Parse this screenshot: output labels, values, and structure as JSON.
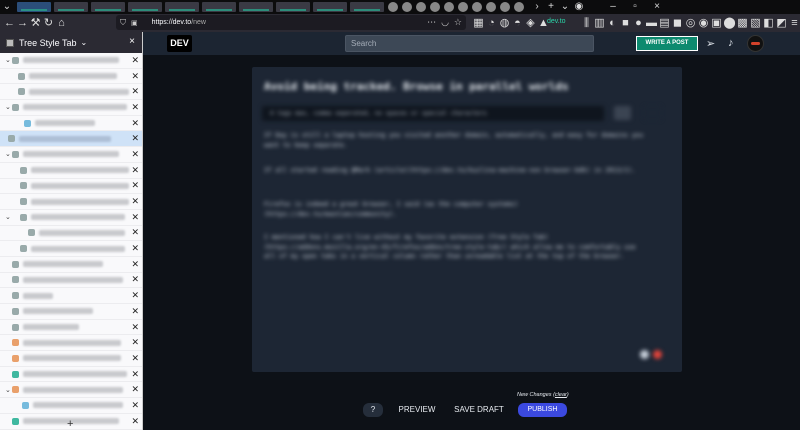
{
  "browser": {
    "url_host": "https://dev.to",
    "url_path": "/new",
    "site_chip": "dev.to"
  },
  "sidebar": {
    "title": "Tree Style Tab",
    "dropdown_glyph": "⌄",
    "close_label": "×",
    "add_label": "+"
  },
  "devto": {
    "logo": "DEV",
    "search_placeholder": "Search",
    "write_post": "WRITE A POST"
  },
  "editor": {
    "title": "Avoid being tracked. Browse in parallel worlds",
    "tags_placeholder": "4 tags max, comma seperated, no spaces or special characters",
    "paragraphs": [
      "If Day is still a laptop hosting you visited another domain, automatically, and easy for domains you want to keep separate.",
      "If all started reading @Mark (article)(https://dev.to/kuzlina-machine-non browser-bdk) in 2013/1).",
      "Firefox is indeed a great browser, I said (as the computer systems) (https://dev.to/mastian/community).",
      "I mentioned how I can't live without my favorite extension (Tree Style Tab)(https://addons.mozilla.org/en-US/firefox/addon/tree-style-tab/) which allow me to comfortably use all of my open tabs in a vertical column rather than unreadable list at the top of the browser."
    ]
  },
  "bottom": {
    "help": "?",
    "preview": "PREVIEW",
    "save": "SAVE DRAFT",
    "new_changes": "New Changes",
    "clear": "clear",
    "publish": "PUBLISH"
  },
  "colors": {
    "accent_green": "#0d8a6f",
    "publish_blue": "#3b49df",
    "page_bg": "#0d1117"
  }
}
